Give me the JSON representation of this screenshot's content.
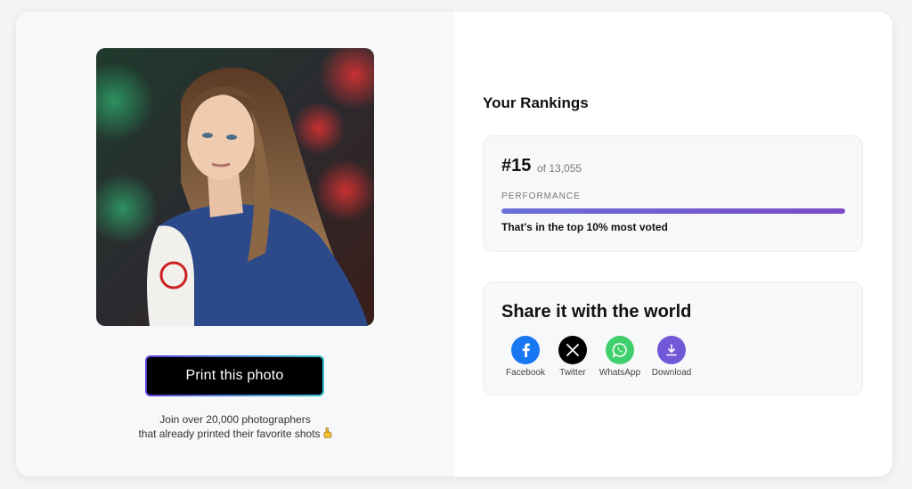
{
  "left": {
    "print_button": "Print this photo",
    "join_line1": "Join over 20,000 photographers",
    "join_line2": "that already printed their favorite shots"
  },
  "rankings": {
    "title": "Your Rankings",
    "rank": "#15",
    "of_total": "of 13,055",
    "performance_label": "PERFORMANCE",
    "performance_fraction": 1.0,
    "note": "That's in the top 10% most voted"
  },
  "share": {
    "title": "Share it with the world",
    "items": [
      {
        "label": "Facebook",
        "icon": "facebook-icon",
        "color": "#1877f2"
      },
      {
        "label": "Twitter",
        "icon": "x-icon",
        "color": "#000000"
      },
      {
        "label": "WhatsApp",
        "icon": "whatsapp-icon",
        "color": "#25d366"
      },
      {
        "label": "Download",
        "icon": "download-icon",
        "color": "#6c5ad6"
      }
    ]
  },
  "colors": {
    "accent_gradient_start": "#5b3fd6",
    "accent_gradient_end": "#36c2d0",
    "bar_start": "#6a6fd8",
    "bar_end": "#7b4cc6"
  }
}
